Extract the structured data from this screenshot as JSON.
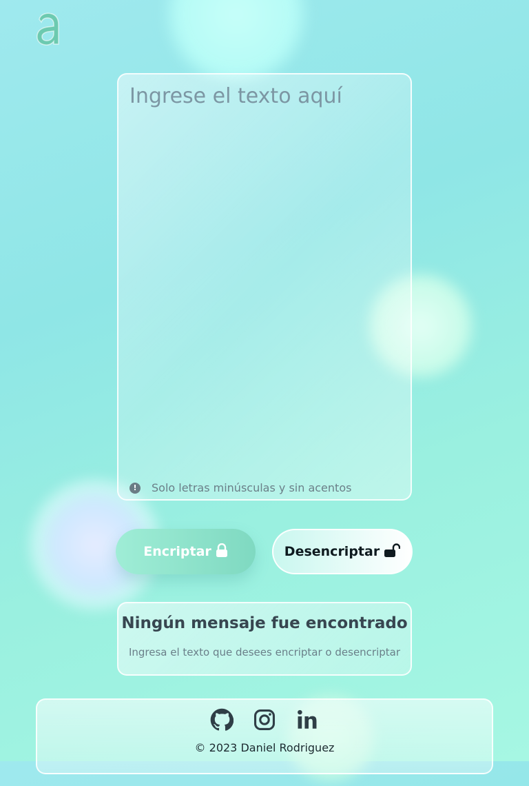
{
  "logo": {
    "letter": "a",
    "color": "#6ccab0"
  },
  "input": {
    "placeholder": "Ingrese el texto aquí",
    "value": ""
  },
  "hint": {
    "text": "Solo letras minúsculas y sin acentos",
    "icon": "exclamation-circle-icon"
  },
  "buttons": {
    "encrypt_label": "Encriptar",
    "encrypt_icon": "lock-icon",
    "decrypt_label": "Desencriptar",
    "decrypt_icon": "unlock-icon"
  },
  "result": {
    "title": "Ningún mensaje fue encontrado",
    "subtitle": "Ingresa el texto que desees encriptar o desencriptar"
  },
  "footer": {
    "social_icons": [
      "github-icon",
      "instagram-icon",
      "linkedin-icon"
    ],
    "copyright": "© 2023 Daniel Rodriguez"
  },
  "colors": {
    "accent": "#7fd9c1",
    "text_dark": "#374650"
  }
}
